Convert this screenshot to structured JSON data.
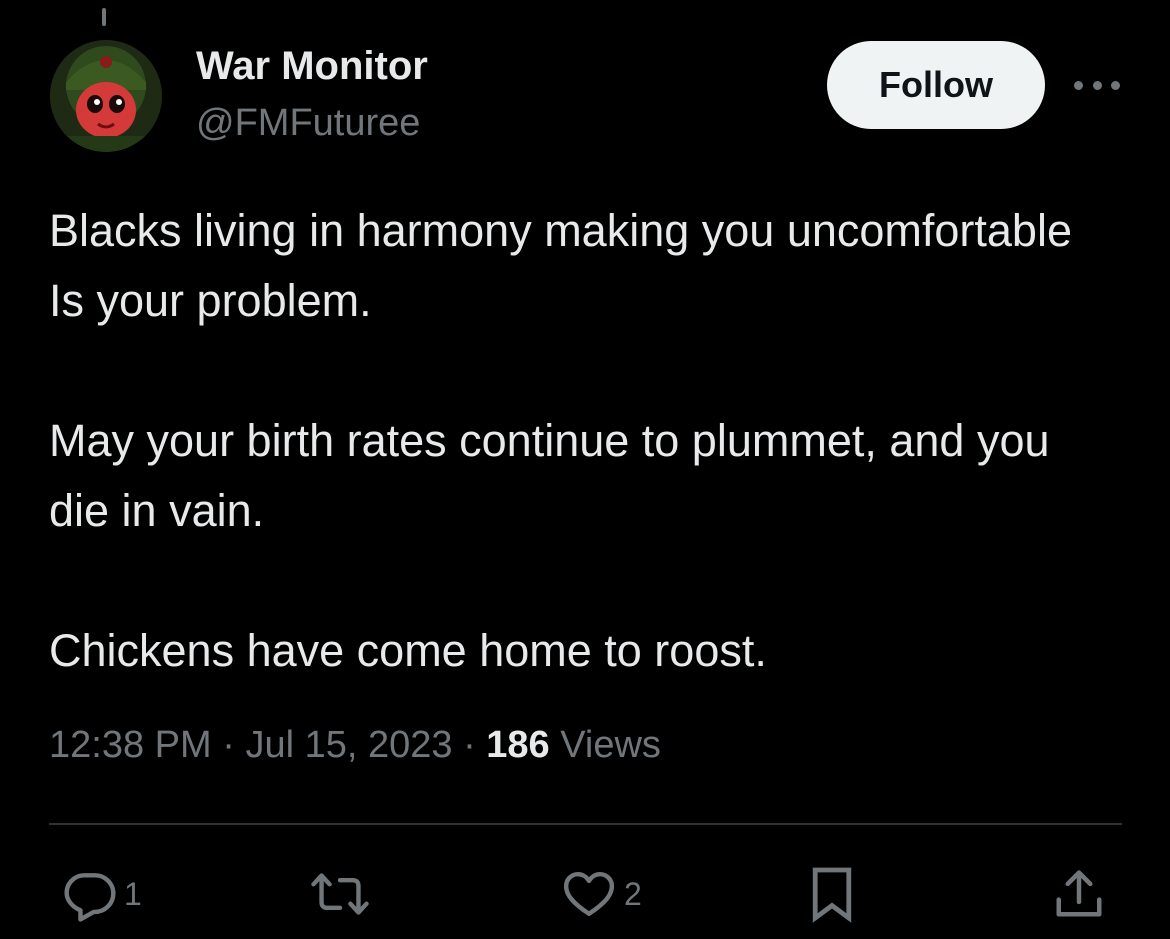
{
  "tweet": {
    "author": {
      "display_name": "War Monitor",
      "handle": "@FMFuturee"
    },
    "follow_label": "Follow",
    "paragraphs": [
      "Blacks living in harmony making you uncomfortable Is your problem.",
      "May your birth rates continue to plummet, and you die in vain.",
      "Chickens have come home to roost."
    ],
    "time": "12:38 PM",
    "separator": "·",
    "date": "Jul 15, 2023",
    "views_count": "186",
    "views_label": "Views"
  },
  "actions": {
    "reply_count": "1",
    "like_count": "2"
  },
  "icons": {
    "reply": "reply-icon",
    "retweet": "retweet-icon",
    "like": "heart-icon",
    "bookmark": "bookmark-icon",
    "share": "share-icon",
    "more": "more-icon"
  },
  "colors": {
    "background": "#000000",
    "text_primary": "#e7e9ea",
    "text_secondary": "#71767b",
    "follow_bg": "#eff3f4",
    "follow_text": "#0f1419",
    "divider": "#2f3336"
  }
}
